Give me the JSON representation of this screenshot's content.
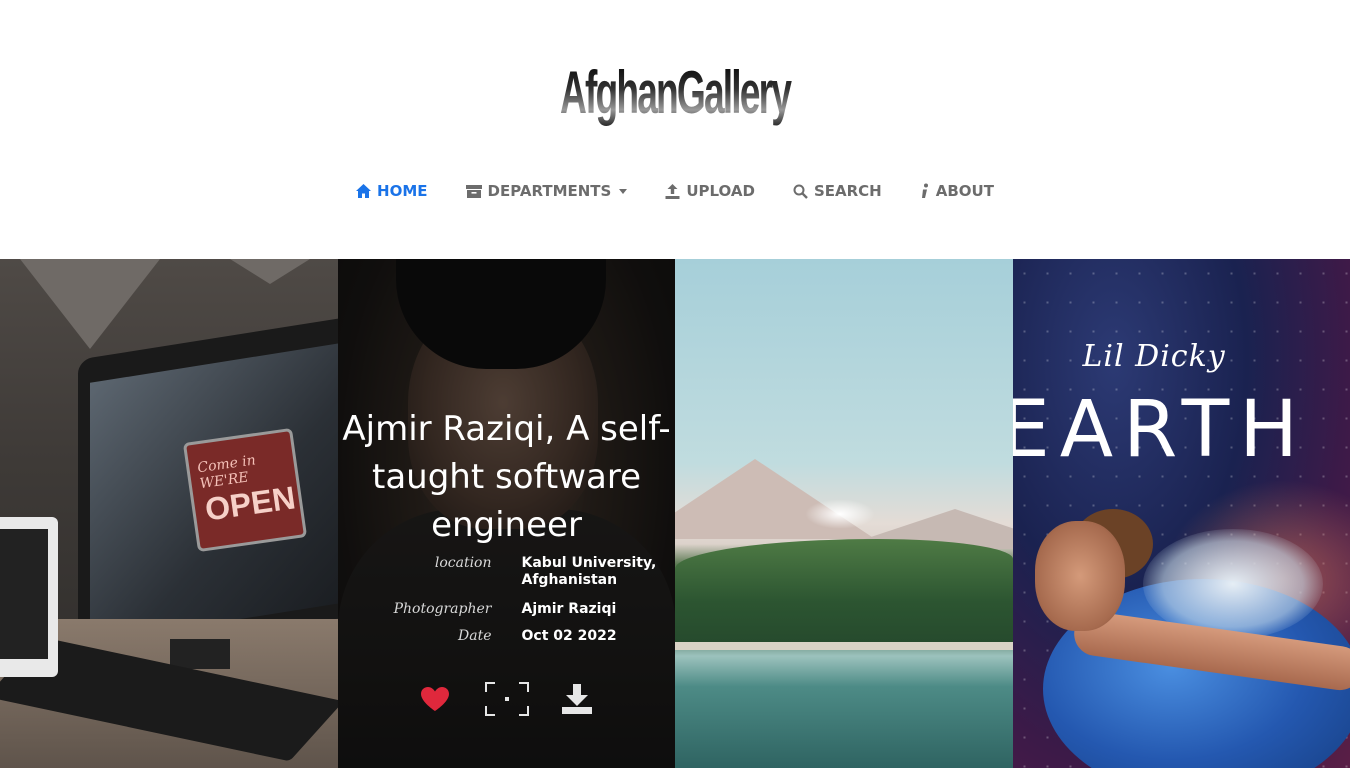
{
  "brand": {
    "logo_text": "AfghanGallery"
  },
  "nav": {
    "items": [
      {
        "label": "HOME",
        "icon": "home-icon",
        "active": true
      },
      {
        "label": "DEPARTMENTS",
        "icon": "archive-icon",
        "has_dropdown": true
      },
      {
        "label": "UPLOAD",
        "icon": "upload-icon"
      },
      {
        "label": "SEARCH",
        "icon": "search-icon"
      },
      {
        "label": "ABOUT",
        "icon": "info-icon"
      }
    ]
  },
  "gallery": {
    "cards": [
      {
        "image": "desk-monitor-open-sign-photo",
        "sign_top": "Come in WE'RE",
        "sign_bottom": "OPEN"
      },
      {
        "image": "portrait-photo",
        "title": "Ajmir Raziqi, A self-taught software engineer",
        "fields": {
          "location_label": "location",
          "location_value": "Kabul University, Afghanistan",
          "photographer_label": "Photographer",
          "photographer_value": "Ajmir Raziqi",
          "date_label": "Date",
          "date_value": "Oct 02 2022"
        },
        "actions": [
          "heart-icon",
          "fullscreen-icon",
          "download-icon"
        ]
      },
      {
        "image": "lake-forest-landscape-photo"
      },
      {
        "image": "earth-poster-photo",
        "poster_signature": "Lil Dicky",
        "poster_title": "EARTH"
      }
    ]
  },
  "colors": {
    "active_nav": "#1a73e8",
    "nav_text": "#6c6c6c",
    "heart": "#e0283c"
  }
}
